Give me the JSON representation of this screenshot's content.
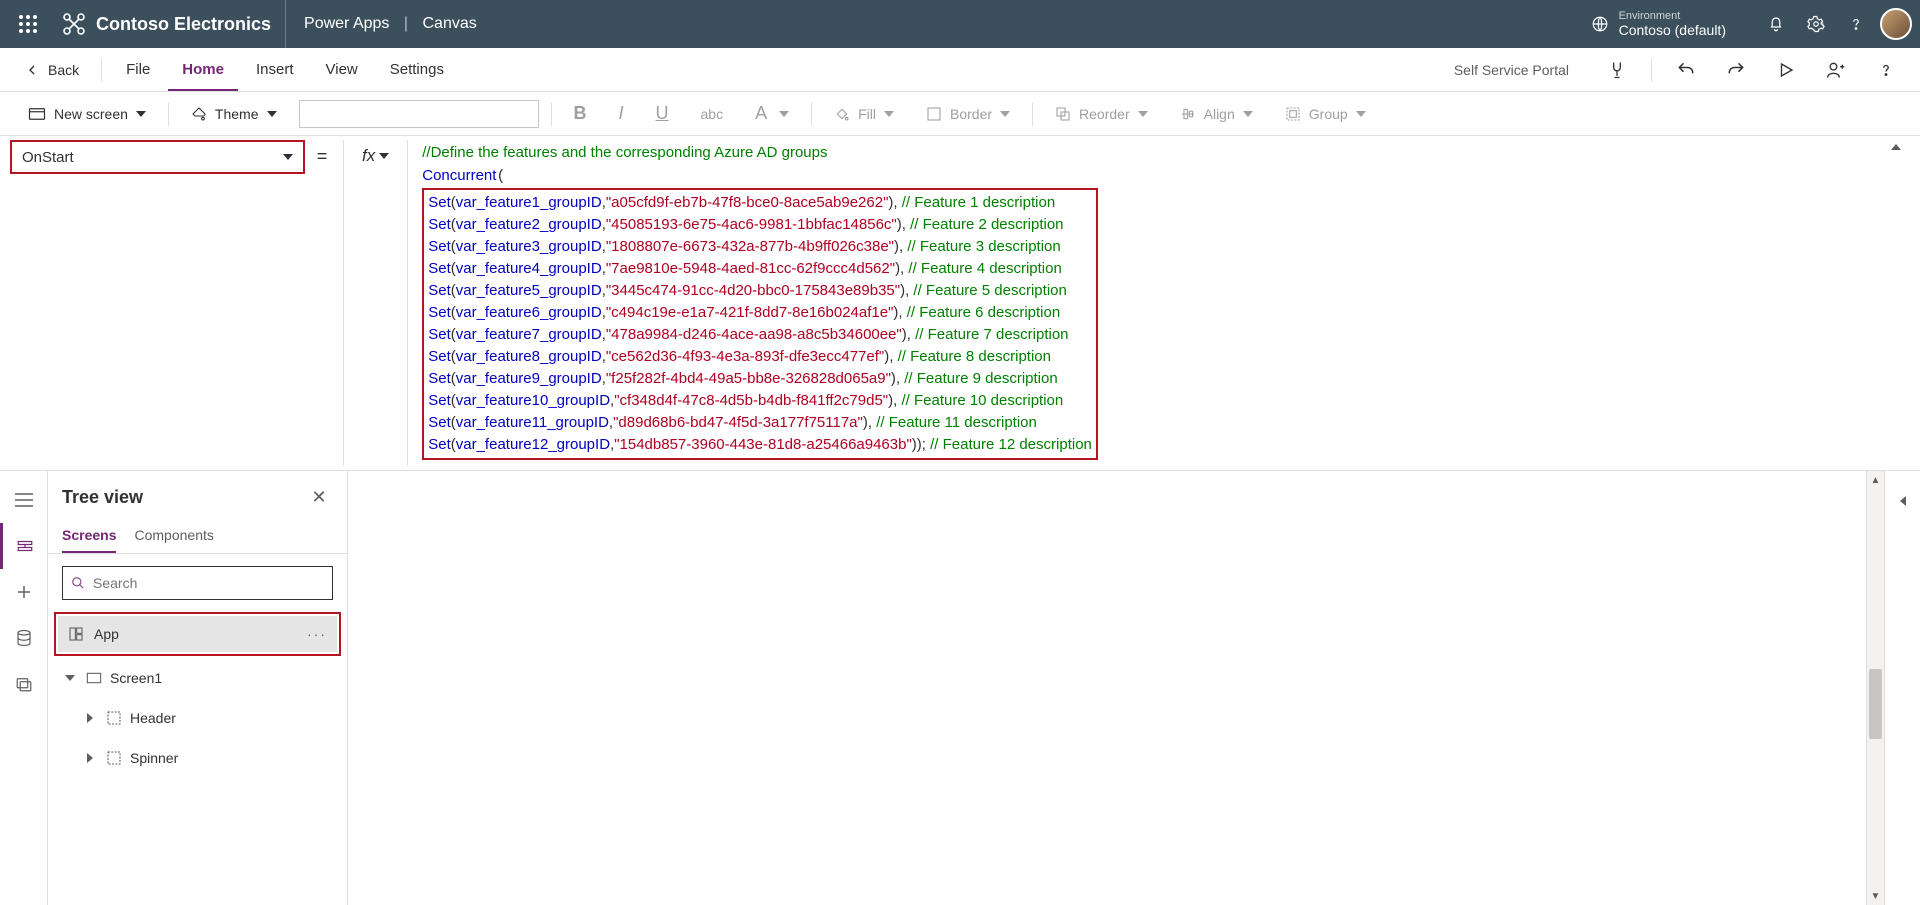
{
  "topbar": {
    "brand": "Contoso Electronics",
    "product": "Power Apps",
    "mode": "Canvas",
    "env_label": "Environment",
    "env_name": "Contoso (default)"
  },
  "menubar": {
    "back": "Back",
    "items": [
      "File",
      "Home",
      "Insert",
      "View",
      "Settings"
    ],
    "active_index": 1,
    "app_name": "Self Service Portal"
  },
  "ribbon": {
    "newscreen": "New screen",
    "theme": "Theme",
    "fill": "Fill",
    "border": "Border",
    "reorder": "Reorder",
    "align": "Align",
    "group": "Group"
  },
  "property_dropdown": "OnStart",
  "formula": {
    "comment0": "//Define the features and the corresponding Azure AD groups",
    "concurrent": "Concurrent",
    "set": "Set",
    "rows": [
      {
        "var": "var_feature1_groupID",
        "guid": "a05cfd9f-eb7b-47f8-bce0-8ace5ab9e262",
        "cmt": "// Feature 1 description"
      },
      {
        "var": "var_feature2_groupID",
        "guid": "45085193-6e75-4ac6-9981-1bbfac14856c",
        "cmt": "// Feature 2 description"
      },
      {
        "var": "var_feature3_groupID",
        "guid": "1808807e-6673-432a-877b-4b9ff026c38e",
        "cmt": "// Feature 3 description"
      },
      {
        "var": "var_feature4_groupID",
        "guid": "7ae9810e-5948-4aed-81cc-62f9ccc4d562",
        "cmt": "// Feature 4 description"
      },
      {
        "var": "var_feature5_groupID",
        "guid": "3445c474-91cc-4d20-bbc0-175843e89b35",
        "cmt": "// Feature 5 description"
      },
      {
        "var": "var_feature6_groupID",
        "guid": "c494c19e-e1a7-421f-8dd7-8e16b024af1e",
        "cmt": "// Feature 6 description"
      },
      {
        "var": "var_feature7_groupID",
        "guid": "478a9984-d246-4ace-aa98-a8c5b34600ee",
        "cmt": "// Feature 7 description"
      },
      {
        "var": "var_feature8_groupID",
        "guid": "ce562d36-4f93-4e3a-893f-dfe3ecc477ef",
        "cmt": "// Feature 8 description"
      },
      {
        "var": "var_feature9_groupID",
        "guid": "f25f282f-4bd4-49a5-bb8e-326828d065a9",
        "cmt": "// Feature 9 description"
      },
      {
        "var": "var_feature10_groupID",
        "guid": "cf348d4f-47c8-4d5b-b4db-f841ff2c79d5",
        "cmt": "// Feature 10 description"
      },
      {
        "var": "var_feature11_groupID",
        "guid": "d89d68b6-bd47-4f5d-3a177f75117a",
        "cmt": "// Feature 11 description"
      },
      {
        "var": "var_feature12_groupID",
        "guid": "154db857-3960-443e-81d8-a25466a9463b",
        "cmt": "// Feature 12 description"
      }
    ]
  },
  "tree": {
    "title": "Tree view",
    "tabs": [
      "Screens",
      "Components"
    ],
    "active_tab": 0,
    "search_placeholder": "Search",
    "app_label": "App",
    "screen1": "Screen1",
    "header": "Header",
    "spinner": "Spinner"
  }
}
